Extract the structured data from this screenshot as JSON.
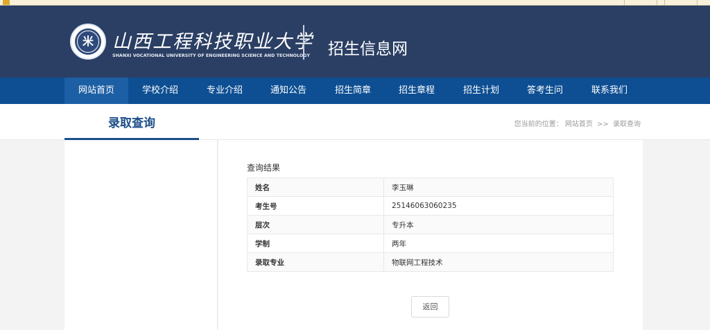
{
  "header": {
    "school_name_cn": "山西工程科技职业大学",
    "school_name_en": "SHANXI VOCATIONAL UNIVERSITY OF ENGINEERING SCIENCE AND TECHNOLOGY",
    "site_title": "招生信息网",
    "logo_glyph": "米"
  },
  "nav": {
    "items": [
      {
        "label": "网站首页"
      },
      {
        "label": "学校介绍"
      },
      {
        "label": "专业介绍"
      },
      {
        "label": "通知公告"
      },
      {
        "label": "招生简章"
      },
      {
        "label": "招生章程"
      },
      {
        "label": "招生计划"
      },
      {
        "label": "答考生问"
      },
      {
        "label": "联系我们"
      }
    ],
    "active_index": 0
  },
  "section": {
    "title": "录取查询",
    "breadcrumb": {
      "prefix": "您当前的位置：",
      "home": "网站首页",
      "separator": ">>",
      "current": "录取查询"
    }
  },
  "result": {
    "heading": "查询结果",
    "rows": [
      {
        "key": "姓名",
        "value": "李玉琳"
      },
      {
        "key": "考生号",
        "value": "25146063060235"
      },
      {
        "key": "层次",
        "value": "专升本"
      },
      {
        "key": "学制",
        "value": "两年"
      },
      {
        "key": "录取专业",
        "value": "物联网工程技术"
      }
    ],
    "back_label": "返回"
  },
  "colors": {
    "header_bg": "#2b3f64",
    "nav_bg": "#0e4f93",
    "accent": "#1c4e88"
  }
}
